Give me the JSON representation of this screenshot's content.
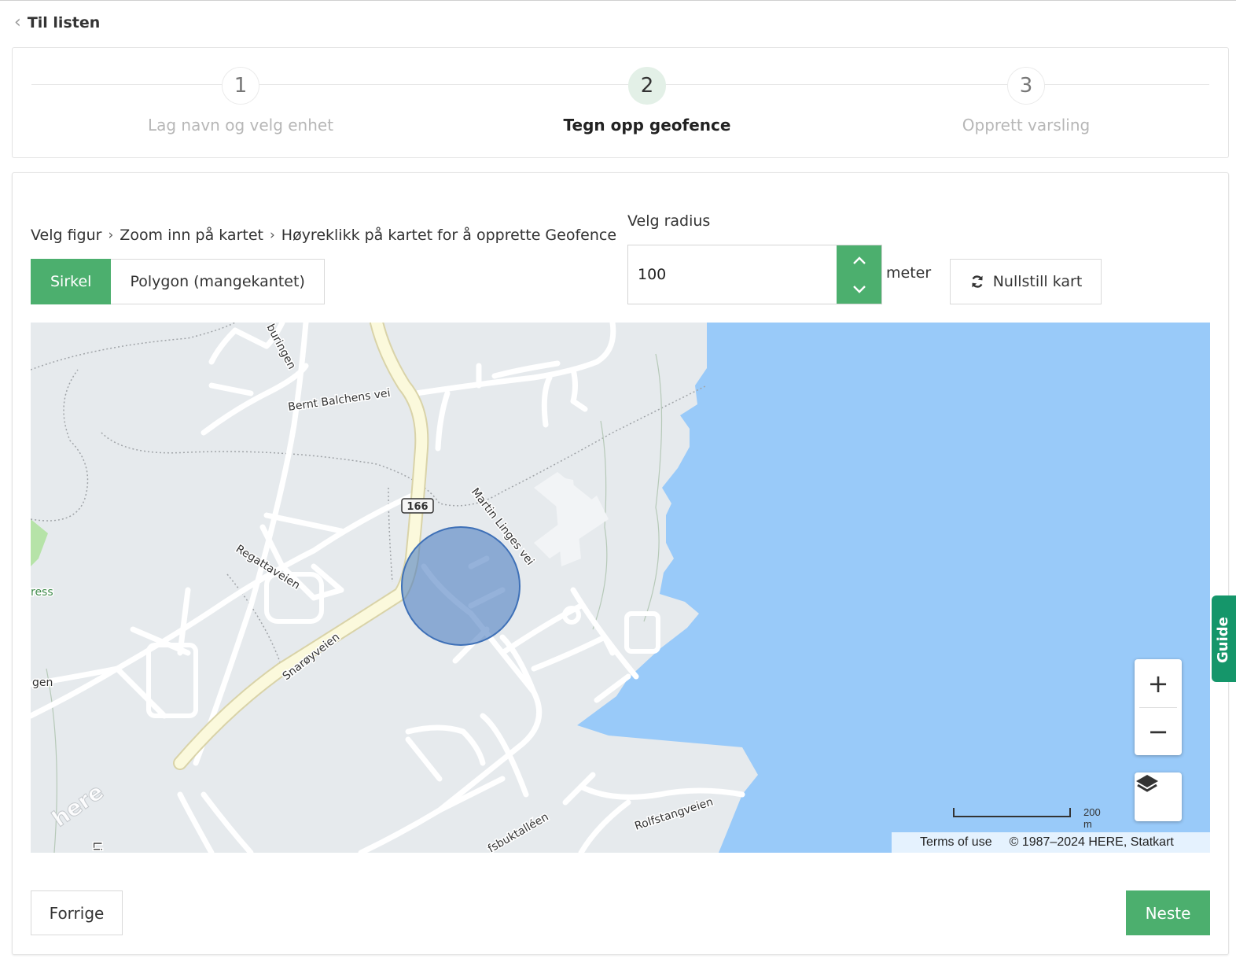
{
  "nav": {
    "back_label": "Til listen"
  },
  "stepper": {
    "steps": [
      {
        "number": "1",
        "label": "Lag navn og velg enhet"
      },
      {
        "number": "2",
        "label": "Tegn opp geofence"
      },
      {
        "number": "3",
        "label": "Opprett varsling"
      }
    ],
    "active_step": 2
  },
  "instructions": {
    "steps": [
      "Velg figur",
      "Zoom inn på kartet",
      "Høyreklikk på kartet for å opprette Geofence"
    ]
  },
  "shape_selector": {
    "options": [
      "Sirkel",
      "Polygon (mangekantet)"
    ],
    "selected": "Sirkel"
  },
  "radius": {
    "label": "Velg radius",
    "value": "100",
    "unit": "meter"
  },
  "reset_button": {
    "label": "Nullstill kart"
  },
  "map": {
    "street_labels": [
      "Bernt Balchens vei",
      "Martin Linges vei",
      "Regattaveien",
      "Snarøyveien",
      "Rolfstangveien",
      "fsbuktalléen",
      "buringen",
      "gen",
      "ress",
      "Li"
    ],
    "route_shield": "166",
    "logo_text": "here",
    "scale_label": "200 m",
    "terms_label": "Terms of use",
    "copyright": "© 1987–2024 HERE, Statkart",
    "zoom_in": "+",
    "zoom_out": "−"
  },
  "guide_tab": {
    "label": "Guide"
  },
  "footer": {
    "prev_label": "Forrige",
    "next_label": "Neste"
  },
  "colors": {
    "accent": "#4caf6e",
    "water": "#99caf9",
    "land": "#e6eaed",
    "geofence": "#4f7fc1",
    "guide": "#15966a"
  }
}
